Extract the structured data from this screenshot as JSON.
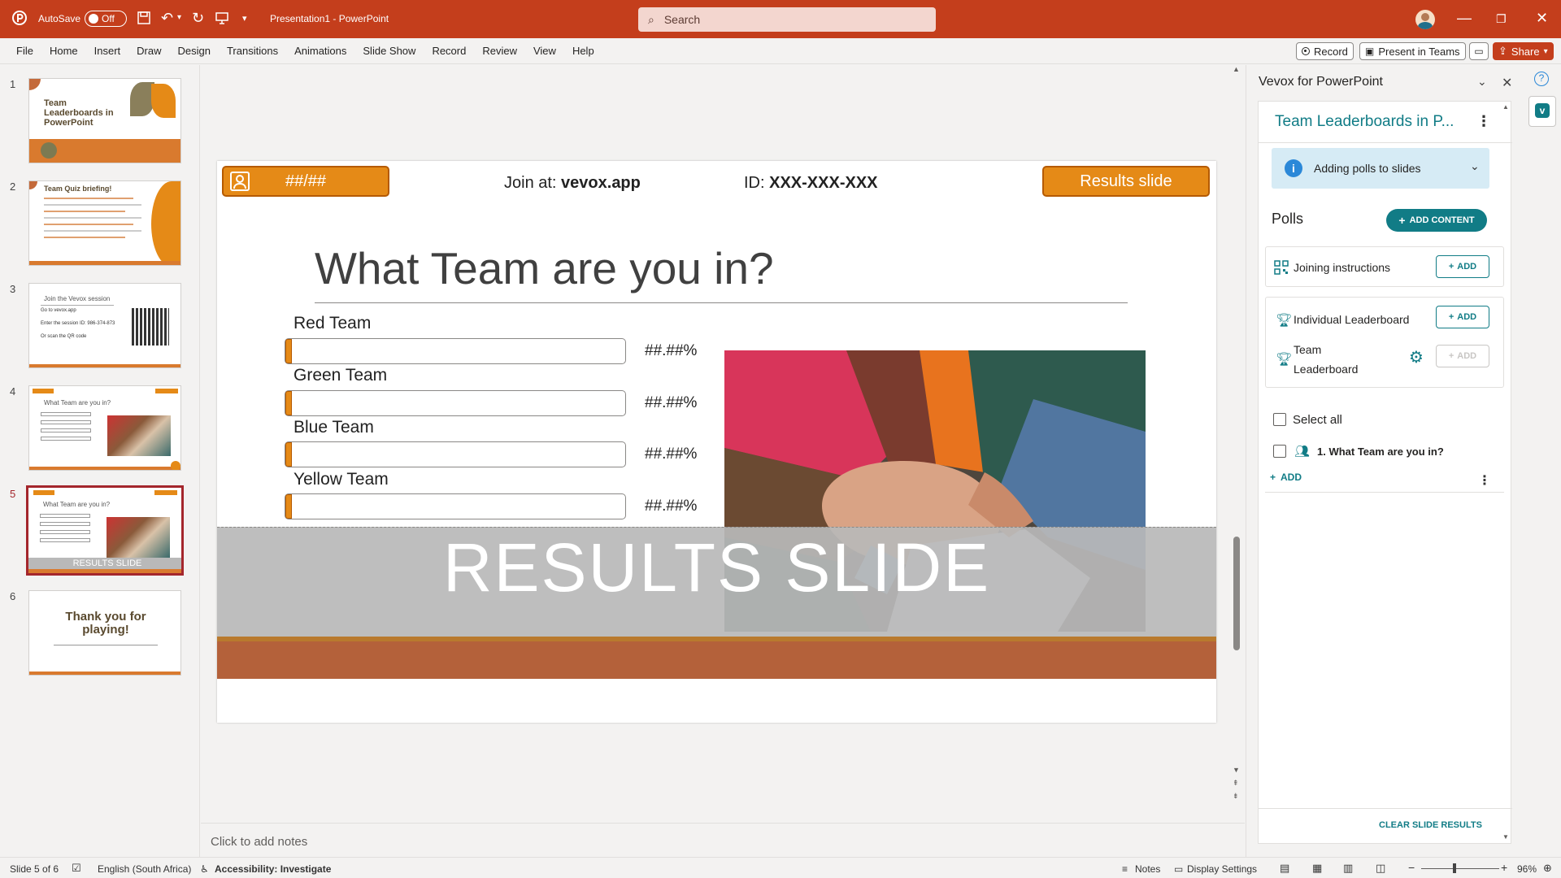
{
  "titlebar": {
    "autosave_label": "AutoSave",
    "autosave_state": "Off",
    "doc_title": "Presentation1 - PowerPoint",
    "search_placeholder": "Search"
  },
  "ribbon": {
    "tabs": [
      "File",
      "Home",
      "Insert",
      "Draw",
      "Design",
      "Transitions",
      "Animations",
      "Slide Show",
      "Record",
      "Review",
      "View",
      "Help"
    ],
    "record_label": "Record",
    "present_teams_label": "Present in Teams",
    "share_label": "Share"
  },
  "thumbnails": {
    "slides": [
      {
        "num": "1",
        "title": "Team Leaderboards in PowerPoint"
      },
      {
        "num": "2",
        "title": "Team Quiz briefing!"
      },
      {
        "num": "3",
        "title": "Join the Vevox session",
        "line1": "Go to vevox.app",
        "line2": "Enter the session ID: 986-374-873",
        "line3": "Or scan the QR code"
      },
      {
        "num": "4",
        "title": "What Team are you in?"
      },
      {
        "num": "5",
        "title": "What Team are you in?",
        "overlay": "RESULTS SLIDE"
      },
      {
        "num": "6",
        "title": "Thank you for playing!"
      }
    ]
  },
  "slide": {
    "counter": "##/##",
    "join_prefix": "Join at: ",
    "join_url": "vevox.app",
    "id_prefix": "ID: ",
    "id_value": "XXX-XXX-XXX",
    "results_button": "Results slide",
    "title": "What Team are you in?",
    "options": [
      {
        "label": "Red Team",
        "pct": "##.##%"
      },
      {
        "label": "Green Team",
        "pct": "##.##%"
      },
      {
        "label": "Blue Team",
        "pct": "##.##%"
      },
      {
        "label": "Yellow Team",
        "pct": "##.##%"
      }
    ],
    "results_banner": "RESULTS SLIDE"
  },
  "notes_placeholder": "Click to add notes",
  "pane": {
    "title": "Vevox for PowerPoint",
    "presentation_name": "Team Leaderboards in P...",
    "info_label": "Adding polls to slides",
    "polls_heading": "Polls",
    "add_content": "ADD CONTENT",
    "joining_instructions": "Joining instructions",
    "individual_leaderboard": "Individual Leaderboard",
    "team_leaderboard_1": "Team",
    "team_leaderboard_2": "Leaderboard",
    "add_label": "ADD",
    "select_all": "Select all",
    "poll_item": "1. What Team are you in?",
    "clear_results": "CLEAR SLIDE RESULTS"
  },
  "statusbar": {
    "slide_of": "Slide 5 of 6",
    "language": "English (South Africa)",
    "accessibility": "Accessibility: Investigate",
    "notes": "Notes",
    "display_settings": "Display Settings",
    "zoom": "96%"
  },
  "colors": {
    "brand": "#c43e1c",
    "slide_orange": "#e58a17",
    "vevox_teal": "#117c86",
    "info_bg": "#d6ebf5"
  }
}
